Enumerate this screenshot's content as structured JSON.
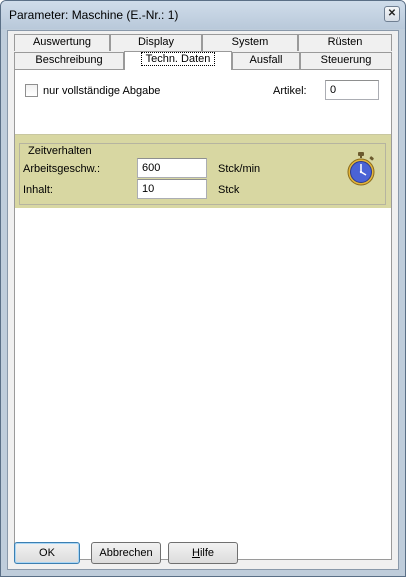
{
  "window": {
    "title": "Parameter: Maschine (E.-Nr.:  1)",
    "close_glyph": "✕"
  },
  "tabs": {
    "row_back": [
      "Auswertung",
      "Display",
      "System",
      "Rüsten"
    ],
    "row_front": [
      "Beschreibung",
      "Techn. Daten",
      "Ausfall",
      "Steuerung"
    ],
    "active": "Techn. Daten"
  },
  "options": {
    "checkbox_label": "nur vollständige Abgabe",
    "checkbox_checked": false,
    "article_label": "Artikel:",
    "article_value": "0"
  },
  "timing": {
    "group_label": "Zeitverhalten",
    "speed_label": "Arbeitsgeschw.:",
    "speed_value": "600",
    "speed_unit": "Stck/min",
    "content_label": "Inhalt:",
    "content_value": "10",
    "content_unit": "Stck",
    "icon": "stopwatch-icon",
    "group_color": "#d8d7a2"
  },
  "buttons": {
    "ok": "OK",
    "cancel": "Abbrechen",
    "help_first": "H",
    "help_rest": "ilfe"
  }
}
